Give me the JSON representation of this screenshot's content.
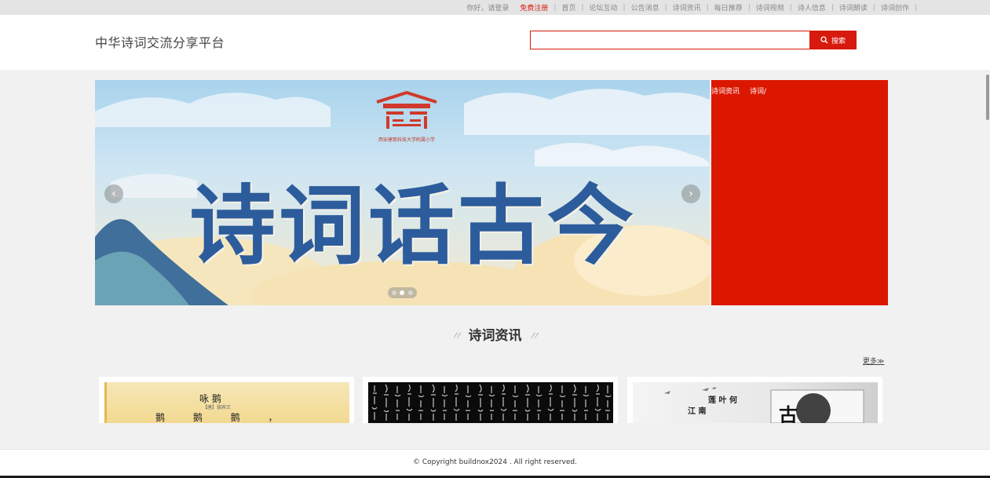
{
  "topbar": {
    "greeting": "你好，请登录",
    "register": "免费注册",
    "nav": [
      "首页",
      "论坛互动",
      "公告消息",
      "诗词资讯",
      "每日推荐",
      "诗词视频",
      "诗人信息",
      "诗词朗读",
      "诗词创作"
    ]
  },
  "header": {
    "site_title": "中华诗词交流分享平台",
    "search_value": "",
    "search_button": "搜索"
  },
  "banner": {
    "headline": "诗词话古今",
    "logo_caption": "西安建筑科技大学附属小学",
    "prev_glyph": "‹",
    "next_glyph": "›",
    "slide_count": 3,
    "active_slide": 2
  },
  "side_panel": {
    "tabs": [
      "诗词资讯",
      "诗词/"
    ]
  },
  "section": {
    "title": "诗词资讯",
    "more": "更多≫"
  },
  "cards": [
    {
      "lines": [
        "咏 鹅",
        "【唐】骆宾王",
        "鹅 鹅 鹅 ，"
      ]
    },
    {
      "lines": []
    },
    {
      "lines": [
        "江 南",
        "莲 叶 何",
        "古"
      ]
    }
  ],
  "footer": {
    "copyright": "© Copyright buildnox2024 . All right reserved."
  },
  "colors": {
    "accent": "#d71a0d",
    "side_panel": "#db1700",
    "banner_text": "#2d5c9c"
  },
  "icons": {
    "search": "magnifier-icon"
  }
}
